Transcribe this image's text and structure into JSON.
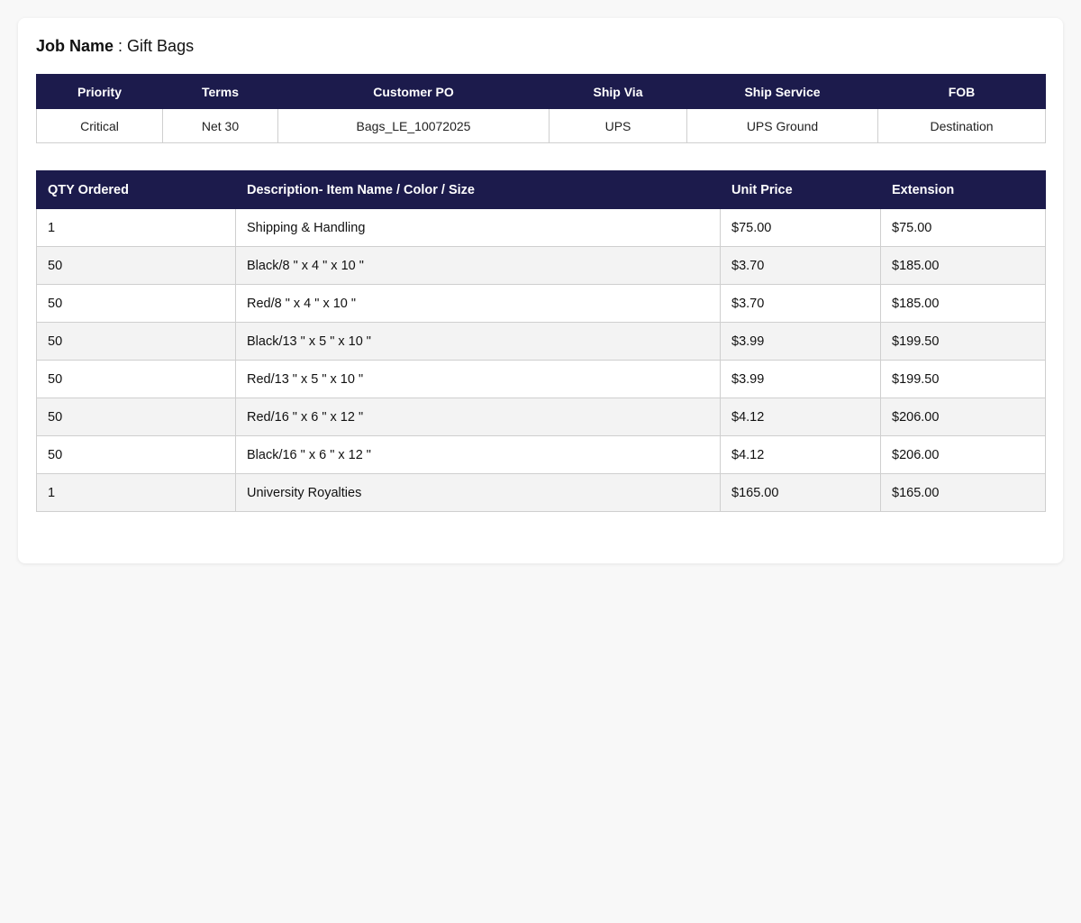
{
  "job": {
    "label": "Job Name",
    "separator": " : ",
    "value": "Gift Bags"
  },
  "meta": {
    "headers": [
      "Priority",
      "Terms",
      "Customer PO",
      "Ship Via",
      "Ship Service",
      "FOB"
    ],
    "values": [
      "Critical",
      "Net 30",
      "Bags_LE_10072025",
      "UPS",
      "UPS Ground",
      "Destination"
    ]
  },
  "items": {
    "headers": [
      "QTY Ordered",
      "Description- Item Name / Color / Size",
      "Unit Price",
      "Extension"
    ],
    "rows": [
      [
        "1",
        "Shipping & Handling",
        "$75.00",
        "$75.00"
      ],
      [
        "50",
        "Black/8 \" x 4 \" x 10 \"",
        "$3.70",
        "$185.00"
      ],
      [
        "50",
        "Red/8 \" x 4 \" x 10 \"",
        "$3.70",
        "$185.00"
      ],
      [
        "50",
        "Black/13 \" x 5 \" x 10 \"",
        "$3.99",
        "$199.50"
      ],
      [
        "50",
        "Red/13 \" x 5 \" x 10 \"",
        "$3.99",
        "$199.50"
      ],
      [
        "50",
        "Red/16 \" x 6 \" x 12 \"",
        "$4.12",
        "$206.00"
      ],
      [
        "50",
        "Black/16 \" x 6 \" x 12 \"",
        "$4.12",
        "$206.00"
      ],
      [
        "1",
        "University Royalties",
        "$165.00",
        "$165.00"
      ]
    ]
  },
  "colors": {
    "header_bg": "#1c1b4c",
    "row_alt": "#f3f3f3",
    "border": "#cfcfcf"
  }
}
